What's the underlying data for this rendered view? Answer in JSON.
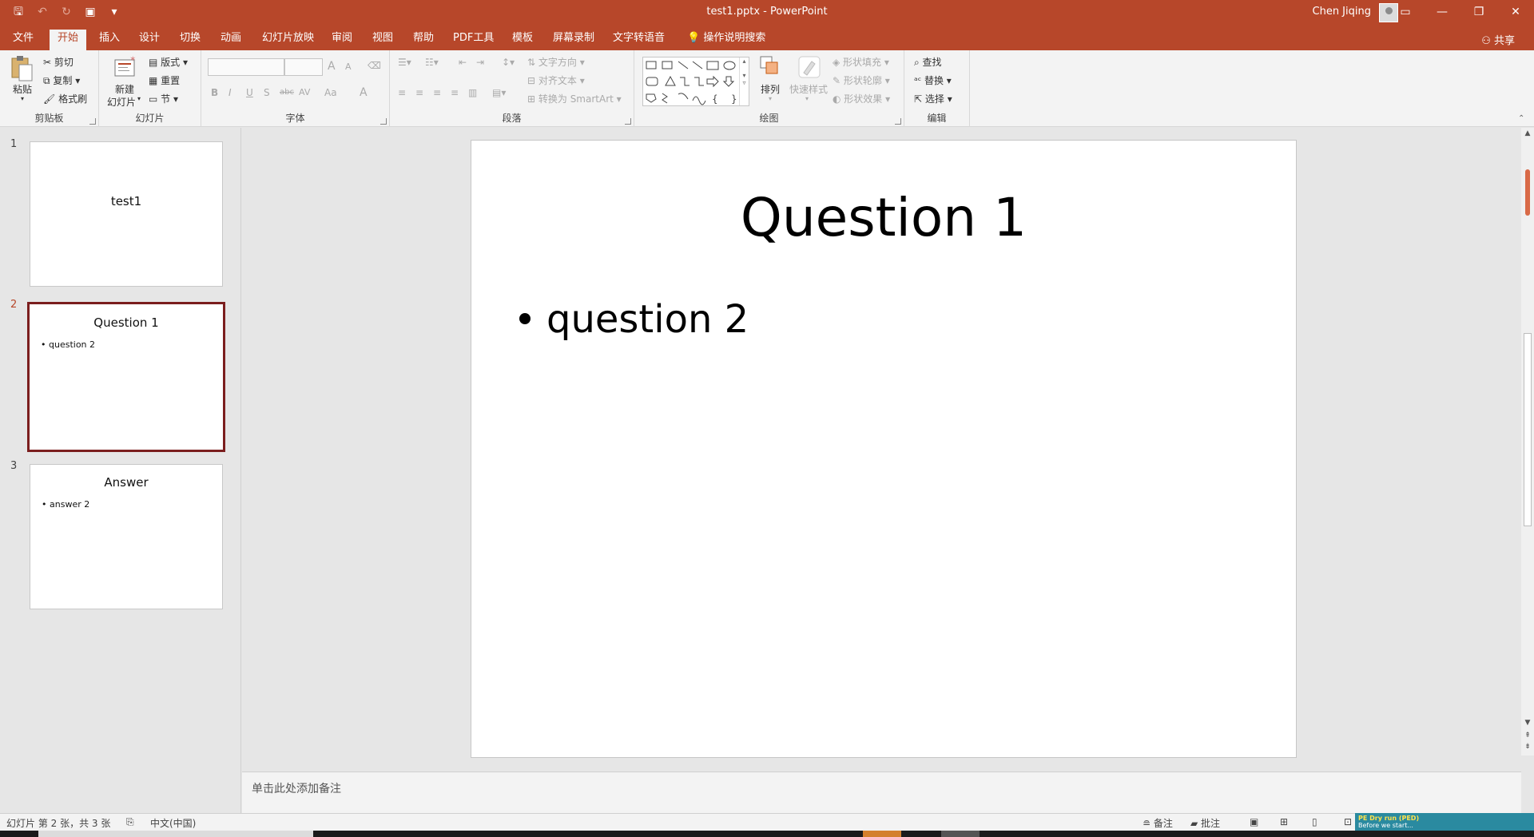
{
  "window": {
    "title": "test1.pptx  -  PowerPoint",
    "user": "Chen Jiqing",
    "controls": [
      "▭",
      "—",
      "❐",
      "✕"
    ]
  },
  "tabs": [
    "文件",
    "开始",
    "插入",
    "设计",
    "切换",
    "动画",
    "幻灯片放映",
    "审阅",
    "视图",
    "帮助",
    "PDF工具",
    "模板",
    "屏幕录制",
    "文字转语音"
  ],
  "tell_me": "操作说明搜索",
  "share": "共享",
  "ribbon": {
    "clipboard": {
      "label": "剪贴板",
      "paste": "粘贴",
      "cut": "剪切",
      "copy": "复制",
      "format_painter": "格式刷"
    },
    "slides": {
      "label": "幻灯片",
      "new_slide_1": "新建",
      "new_slide_2": "幻灯片",
      "layout": "版式",
      "reset": "重置",
      "section": "节"
    },
    "font": {
      "label": "字体",
      "bold": "B",
      "italic": "I",
      "underline": "U",
      "shadow": "S",
      "strike": "abc",
      "spacing": "AV",
      "case": "Aa",
      "color": "A",
      "grow": "A",
      "shrink": "A"
    },
    "paragraph": {
      "label": "段落",
      "text_direction": "文字方向",
      "align_text": "对齐文本",
      "smartart": "转换为 SmartArt"
    },
    "drawing": {
      "label": "绘图",
      "arrange": "排列",
      "quick_styles": "快速样式",
      "shape_fill": "形状填充",
      "shape_outline": "形状轮廓",
      "shape_effects": "形状效果"
    },
    "editing": {
      "label": "编辑",
      "find": "查找",
      "replace": "替换",
      "select": "选择"
    }
  },
  "slides": [
    {
      "num": "1",
      "title": "test1",
      "bullets": []
    },
    {
      "num": "2",
      "title": "Question 1",
      "bullets": [
        "question 2"
      ]
    },
    {
      "num": "3",
      "title": "Answer",
      "bullets": [
        "answer 2"
      ]
    }
  ],
  "current_slide": {
    "title": "Question 1",
    "bullet": "question 2"
  },
  "notes_placeholder": "单击此处添加备注",
  "status": {
    "slide_info": "幻灯片 第 2 张，共 3 张",
    "language": "中文(中国)",
    "notes": "备注",
    "comments": "批注"
  },
  "notification": {
    "title": "PE Dry run (PED)",
    "line2": "Before we start..."
  },
  "colors": {
    "accent": "#b7472a",
    "selected_border": "#7b1e1e"
  }
}
